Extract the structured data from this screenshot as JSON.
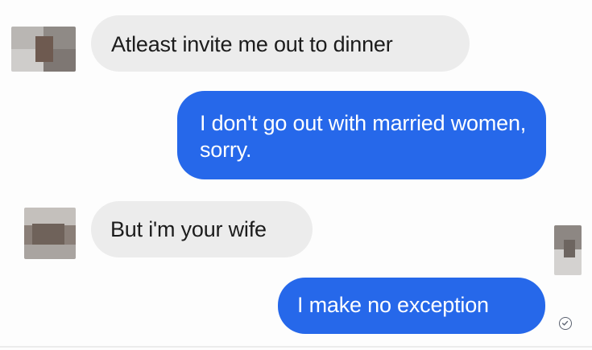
{
  "messages": [
    {
      "direction": "incoming",
      "text": "Atleast invite me out to dinner"
    },
    {
      "direction": "outgoing",
      "text": "I don't go out with married women, sorry."
    },
    {
      "direction": "incoming",
      "text": "But i'm your wife"
    },
    {
      "direction": "outgoing",
      "text": "I make no exception"
    }
  ],
  "colors": {
    "incoming_bubble": "#ececec",
    "outgoing_bubble": "#2668ea",
    "outgoing_text": "#ffffff",
    "incoming_text": "#1c1c1c"
  },
  "icons": {
    "read_receipt": "check-circle-icon",
    "avatars": "blurred-avatar"
  }
}
